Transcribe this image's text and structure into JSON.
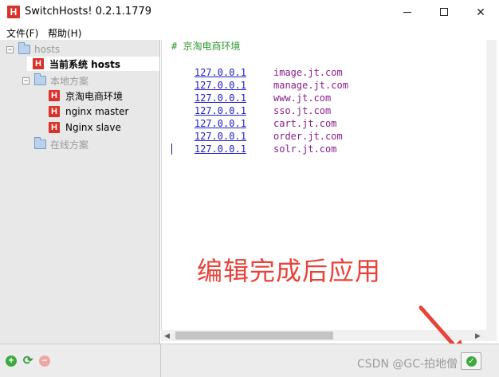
{
  "window": {
    "app_icon_letter": "H",
    "title": "SwitchHosts! 0.2.1.1779"
  },
  "menu": {
    "file": "文件(F)",
    "help": "帮助(H)"
  },
  "sidebar": {
    "root": "hosts",
    "current_system": "当前系统 hosts",
    "local_group": "本地方案",
    "local_items": [
      "京淘电商环境",
      "nginx master",
      "Nginx slave"
    ],
    "online_group": "在线方案"
  },
  "editor": {
    "comment": "# 京淘电商环境",
    "entries": [
      {
        "ip": "127.0.0.1",
        "host": "image.jt.com"
      },
      {
        "ip": "127.0.0.1",
        "host": "manage.jt.com"
      },
      {
        "ip": "127.0.0.1",
        "host": "www.jt.com"
      },
      {
        "ip": "127.0.0.1",
        "host": "sso.jt.com"
      },
      {
        "ip": "127.0.0.1",
        "host": "cart.jt.com"
      },
      {
        "ip": "127.0.0.1",
        "host": "order.jt.com"
      },
      {
        "ip": "127.0.0.1",
        "host": "solr.jt.com"
      }
    ],
    "annotation": "编辑完成后应用"
  },
  "footer": {
    "watermark": "CSDN @GC-拍地僧"
  },
  "colors": {
    "brand_red": "#d8322b",
    "comment_green": "#2e9a2e",
    "ip_blue": "#2020c8",
    "host_purple": "#8a1e8a",
    "annotation_red": "#e8433a"
  }
}
